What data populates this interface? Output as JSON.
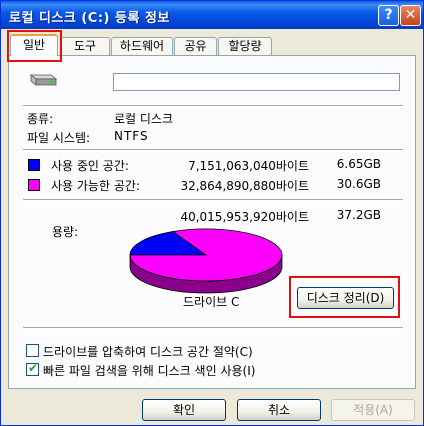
{
  "window": {
    "title": "로컬 디스크 (C:) 등록 정보",
    "help_glyph": "?",
    "close_glyph": "✕"
  },
  "tabs": [
    {
      "label": "일반",
      "active": true
    },
    {
      "label": "도구",
      "active": false
    },
    {
      "label": "하드웨어",
      "active": false
    },
    {
      "label": "공유",
      "active": false
    },
    {
      "label": "할당량",
      "active": false
    }
  ],
  "general": {
    "drive_name_value": "",
    "type_label": "종류:",
    "type_value": "로컬 디스크",
    "fs_label": "파일 시스템:",
    "fs_value": "NTFS",
    "used_label": "사용 중인 공간:",
    "used_bytes": "7,151,063,040바이트",
    "used_gb": "6.65GB",
    "free_label": "사용 가능한 공간:",
    "free_bytes": "32,864,890,880바이트",
    "free_gb": "30.6GB",
    "capacity_label": "용량:",
    "capacity_bytes": "40,015,953,920바이트",
    "capacity_gb": "37.2GB",
    "drive_label": "드라이브 C",
    "cleanup_button": "디스크 정리(D)",
    "compress_label": "드라이브를 압축하여 디스크 공간 절약(C)",
    "compress_checked": false,
    "index_label": "빠른 파일 검색을 위해 디스크 색인 사용(I)",
    "index_checked": true
  },
  "colors": {
    "used": "#0000ff",
    "free": "#ff00ff",
    "title_bar": "#0a5ae8",
    "highlight": "#e01010"
  },
  "chart_data": {
    "type": "pie",
    "values": [
      6.65,
      30.6
    ],
    "labels": [
      "사용 중인 공간",
      "사용 가능한 공간"
    ]
  },
  "footer": {
    "ok": "확인",
    "cancel": "취소",
    "apply": "적용(A)"
  }
}
